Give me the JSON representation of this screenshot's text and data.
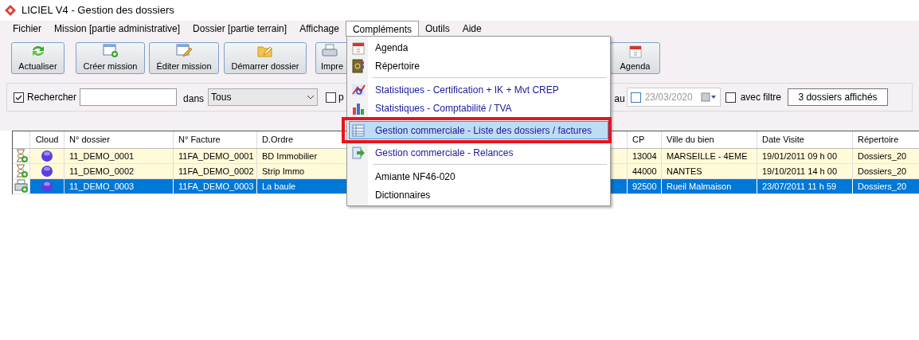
{
  "window": {
    "title": "LICIEL V4 - Gestion des dossiers"
  },
  "menubar": [
    {
      "label": "Fichier",
      "selected": false
    },
    {
      "label": "Mission [partie administrative]",
      "selected": false
    },
    {
      "label": "Dossier [partie terrain]",
      "selected": false
    },
    {
      "label": "Affichage",
      "selected": false
    },
    {
      "label": "Compléments",
      "selected": true
    },
    {
      "label": "Outils",
      "selected": false
    },
    {
      "label": "Aide",
      "selected": false
    }
  ],
  "toolbar": [
    {
      "label": "Actualiser"
    },
    {
      "label": "Créer mission"
    },
    {
      "label": "Éditer mission"
    },
    {
      "label": "Démarrer dossier"
    },
    {
      "label": "Impre"
    },
    {
      "label": "Agenda"
    }
  ],
  "filter": {
    "search_checked": true,
    "search_label": "Rechercher",
    "in_label": "dans",
    "scope": "Tous",
    "option_checked": false,
    "option_label": "p",
    "date_label": "au",
    "date_checked": false,
    "date": "23/03/2020",
    "filter_checked": false,
    "filter_label": "avec filtre",
    "count": "3 dossiers affichés"
  },
  "table": {
    "columns": [
      "",
      "Cloud",
      "N° dossier",
      "N° Facture",
      "D.Ordre",
      "CP",
      "Ville du bien",
      "Date Visite",
      "Répertoire"
    ],
    "rows": [
      {
        "kind": "pending",
        "selected": false,
        "cells": [
          "",
          "",
          "11_DEMO_0001",
          "11FA_DEMO_0001",
          "BD Immobilier",
          "13004",
          "MARSEILLE - 4EME",
          "19/01/2011 09 h 00",
          "Dossiers_20"
        ]
      },
      {
        "kind": "pending",
        "selected": false,
        "cells": [
          "",
          "",
          "11_DEMO_0002",
          "11FA_DEMO_0002",
          "Strip Immo",
          "44000",
          "NANTES",
          "19/10/2011 14 h 00",
          "Dossiers_20"
        ]
      },
      {
        "kind": "printed",
        "selected": true,
        "cells": [
          "",
          "",
          "11_DEMO_0003",
          "11FA_DEMO_0003",
          "La baule",
          "92500",
          "Rueil Malmaison",
          "23/07/2011 11 h 59",
          "Dossiers_20"
        ]
      }
    ]
  },
  "dropdown": [
    {
      "kind": "item",
      "label": "Agenda",
      "selected": false,
      "marked": false
    },
    {
      "kind": "item",
      "label": "Répertoire",
      "selected": false,
      "marked": false
    },
    {
      "kind": "separator"
    },
    {
      "kind": "module",
      "label": "Statistiques - Certification + IK + Mvt CREP",
      "selected": false,
      "marked": false
    },
    {
      "kind": "module",
      "label": "Statistiques - Comptabilité / TVA",
      "selected": false,
      "marked": false
    },
    {
      "kind": "module",
      "label": "Gestion commerciale - Liste des dossiers / factures",
      "selected": true,
      "marked": true
    },
    {
      "kind": "module",
      "label": "Gestion commerciale - Relances",
      "selected": false,
      "marked": false
    },
    {
      "kind": "separator"
    },
    {
      "kind": "item",
      "label": "Amiante NF46-020",
      "selected": false,
      "marked": false
    },
    {
      "kind": "item",
      "label": "Dictionnaires",
      "selected": false,
      "marked": false
    }
  ]
}
